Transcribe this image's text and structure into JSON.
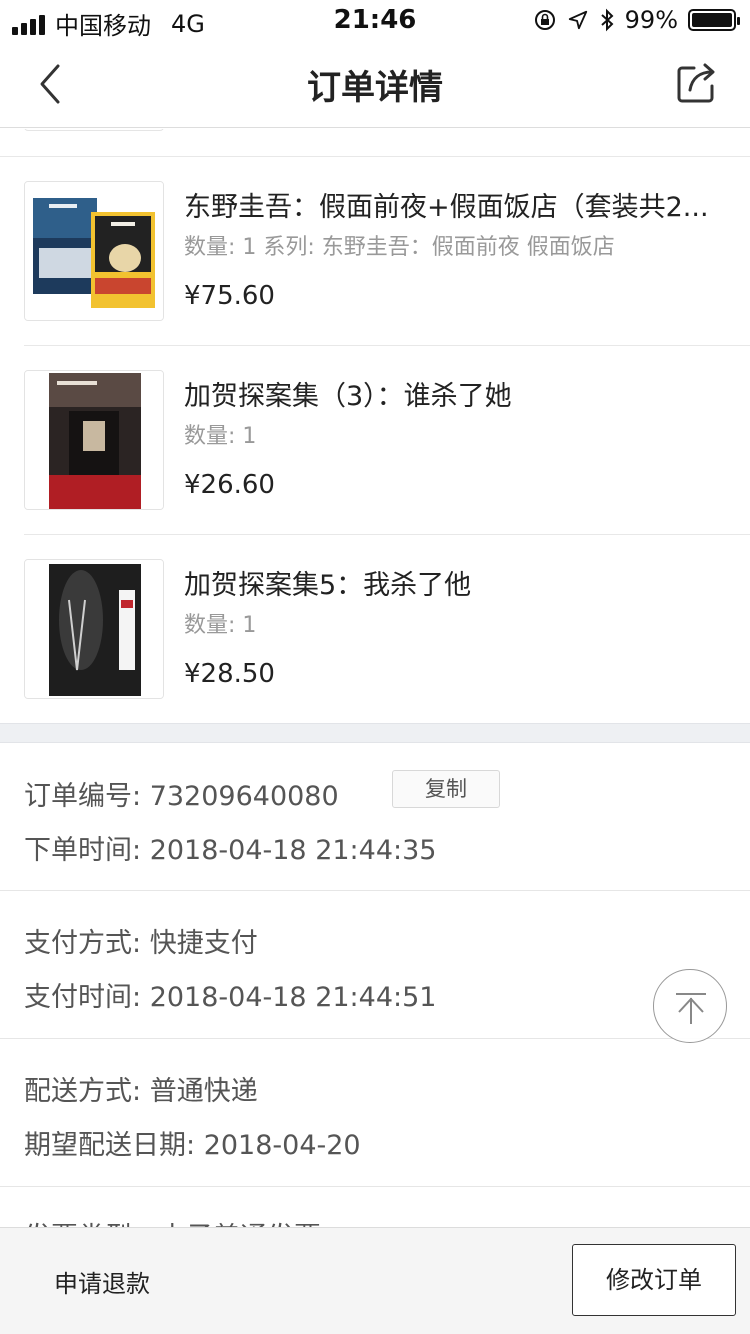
{
  "status_bar": {
    "carrier": "中国移动",
    "network": "4G",
    "time": "21:46",
    "battery": "99%",
    "battery_level": 0.99
  },
  "nav": {
    "title": "订单详情",
    "back_icon": "chevron-left-icon",
    "share_icon": "share-icon"
  },
  "items": [
    {
      "title": "东野圭吾：假面前夜+假面饭店（套装共2...",
      "meta": "数量: 1 系列: 东野圭吾：假面前夜 假面饭店",
      "price": "¥75.60"
    },
    {
      "title": "加贺探案集（3）：谁杀了她",
      "meta": "数量: 1",
      "price": "¥26.60"
    },
    {
      "title": "加贺探案集5：我杀了他",
      "meta": "数量: 1",
      "price": "¥28.50"
    }
  ],
  "order": {
    "number_label": "订单编号:",
    "number_value": "73209640080",
    "copy_label": "复制",
    "time_label": "下单时间:",
    "time_value": "2018-04-18 21:44:35"
  },
  "payment": {
    "method_label": "支付方式:",
    "method_value": "快捷支付",
    "time_label": "支付时间:",
    "time_value": "2018-04-18 21:44:51"
  },
  "delivery": {
    "method_label": "配送方式:",
    "method_value": "普通快递",
    "date_label": "期望配送日期:",
    "date_value": "2018-04-20"
  },
  "invoice_partial": "发票类型：电子普通发票",
  "bottom": {
    "refund_label": "申请退款",
    "modify_label": "修改订单"
  }
}
